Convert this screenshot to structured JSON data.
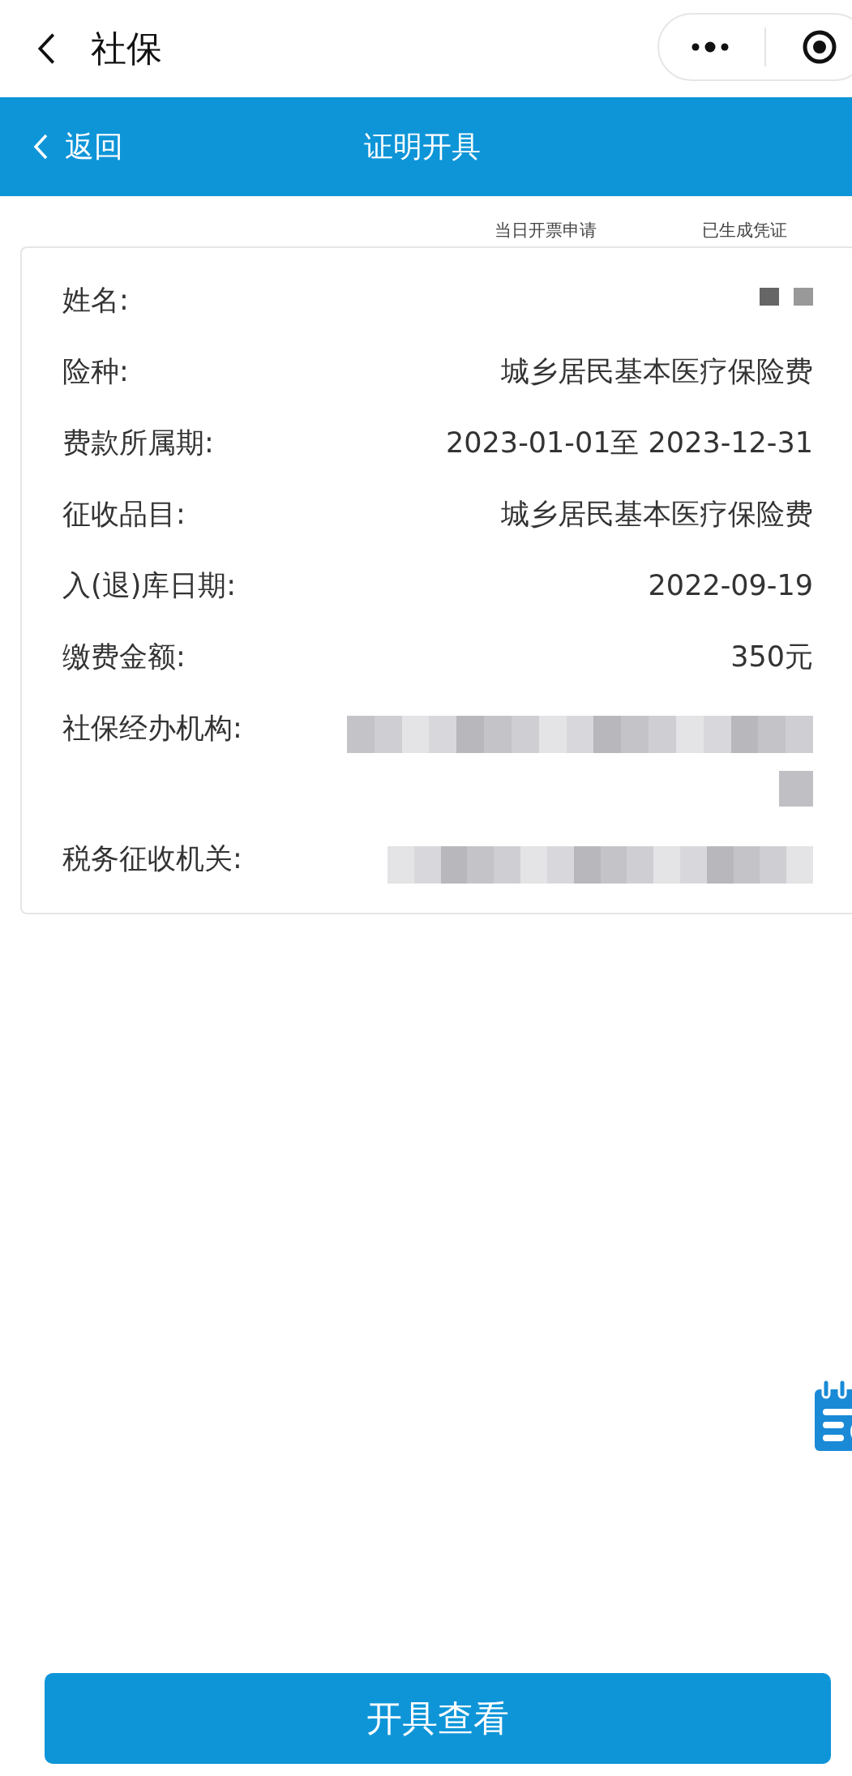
{
  "mini_program_bar": {
    "title": "社保"
  },
  "header": {
    "back_label": "返回",
    "title": "证明开具"
  },
  "tabs": [
    {
      "label": "当日开票申请"
    },
    {
      "label": "已生成凭证"
    }
  ],
  "details": [
    {
      "label": "姓名:",
      "kind": "redacted_short"
    },
    {
      "label": "险种:",
      "kind": "text",
      "value": "城乡居民基本医疗保险费"
    },
    {
      "label": "费款所属期:",
      "kind": "text",
      "value": "2023-01-01至 2023-12-31"
    },
    {
      "label": "征收品目:",
      "kind": "text",
      "value": "城乡居民基本医疗保险费"
    },
    {
      "label": "入(退)库日期:",
      "kind": "text",
      "value": "2022-09-19"
    },
    {
      "label": "缴费金额:",
      "kind": "text",
      "value": "350元"
    },
    {
      "label": "社保经办机构:",
      "kind": "redacted_wrapped"
    },
    {
      "label": "税务征收机关:",
      "kind": "redacted_long"
    }
  ],
  "primary_button": {
    "label": "开具查看"
  }
}
